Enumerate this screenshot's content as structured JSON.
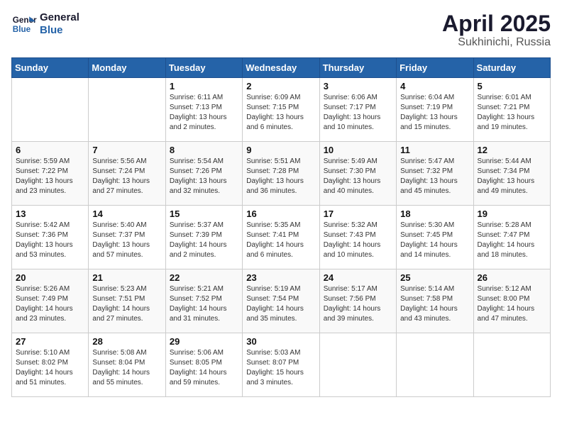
{
  "header": {
    "logo_line1": "General",
    "logo_line2": "Blue",
    "month": "April 2025",
    "location": "Sukhinichi, Russia"
  },
  "weekdays": [
    "Sunday",
    "Monday",
    "Tuesday",
    "Wednesday",
    "Thursday",
    "Friday",
    "Saturday"
  ],
  "weeks": [
    [
      {
        "day": "",
        "info": ""
      },
      {
        "day": "",
        "info": ""
      },
      {
        "day": "1",
        "info": "Sunrise: 6:11 AM\nSunset: 7:13 PM\nDaylight: 13 hours and 2 minutes."
      },
      {
        "day": "2",
        "info": "Sunrise: 6:09 AM\nSunset: 7:15 PM\nDaylight: 13 hours and 6 minutes."
      },
      {
        "day": "3",
        "info": "Sunrise: 6:06 AM\nSunset: 7:17 PM\nDaylight: 13 hours and 10 minutes."
      },
      {
        "day": "4",
        "info": "Sunrise: 6:04 AM\nSunset: 7:19 PM\nDaylight: 13 hours and 15 minutes."
      },
      {
        "day": "5",
        "info": "Sunrise: 6:01 AM\nSunset: 7:21 PM\nDaylight: 13 hours and 19 minutes."
      }
    ],
    [
      {
        "day": "6",
        "info": "Sunrise: 5:59 AM\nSunset: 7:22 PM\nDaylight: 13 hours and 23 minutes."
      },
      {
        "day": "7",
        "info": "Sunrise: 5:56 AM\nSunset: 7:24 PM\nDaylight: 13 hours and 27 minutes."
      },
      {
        "day": "8",
        "info": "Sunrise: 5:54 AM\nSunset: 7:26 PM\nDaylight: 13 hours and 32 minutes."
      },
      {
        "day": "9",
        "info": "Sunrise: 5:51 AM\nSunset: 7:28 PM\nDaylight: 13 hours and 36 minutes."
      },
      {
        "day": "10",
        "info": "Sunrise: 5:49 AM\nSunset: 7:30 PM\nDaylight: 13 hours and 40 minutes."
      },
      {
        "day": "11",
        "info": "Sunrise: 5:47 AM\nSunset: 7:32 PM\nDaylight: 13 hours and 45 minutes."
      },
      {
        "day": "12",
        "info": "Sunrise: 5:44 AM\nSunset: 7:34 PM\nDaylight: 13 hours and 49 minutes."
      }
    ],
    [
      {
        "day": "13",
        "info": "Sunrise: 5:42 AM\nSunset: 7:36 PM\nDaylight: 13 hours and 53 minutes."
      },
      {
        "day": "14",
        "info": "Sunrise: 5:40 AM\nSunset: 7:37 PM\nDaylight: 13 hours and 57 minutes."
      },
      {
        "day": "15",
        "info": "Sunrise: 5:37 AM\nSunset: 7:39 PM\nDaylight: 14 hours and 2 minutes."
      },
      {
        "day": "16",
        "info": "Sunrise: 5:35 AM\nSunset: 7:41 PM\nDaylight: 14 hours and 6 minutes."
      },
      {
        "day": "17",
        "info": "Sunrise: 5:32 AM\nSunset: 7:43 PM\nDaylight: 14 hours and 10 minutes."
      },
      {
        "day": "18",
        "info": "Sunrise: 5:30 AM\nSunset: 7:45 PM\nDaylight: 14 hours and 14 minutes."
      },
      {
        "day": "19",
        "info": "Sunrise: 5:28 AM\nSunset: 7:47 PM\nDaylight: 14 hours and 18 minutes."
      }
    ],
    [
      {
        "day": "20",
        "info": "Sunrise: 5:26 AM\nSunset: 7:49 PM\nDaylight: 14 hours and 23 minutes."
      },
      {
        "day": "21",
        "info": "Sunrise: 5:23 AM\nSunset: 7:51 PM\nDaylight: 14 hours and 27 minutes."
      },
      {
        "day": "22",
        "info": "Sunrise: 5:21 AM\nSunset: 7:52 PM\nDaylight: 14 hours and 31 minutes."
      },
      {
        "day": "23",
        "info": "Sunrise: 5:19 AM\nSunset: 7:54 PM\nDaylight: 14 hours and 35 minutes."
      },
      {
        "day": "24",
        "info": "Sunrise: 5:17 AM\nSunset: 7:56 PM\nDaylight: 14 hours and 39 minutes."
      },
      {
        "day": "25",
        "info": "Sunrise: 5:14 AM\nSunset: 7:58 PM\nDaylight: 14 hours and 43 minutes."
      },
      {
        "day": "26",
        "info": "Sunrise: 5:12 AM\nSunset: 8:00 PM\nDaylight: 14 hours and 47 minutes."
      }
    ],
    [
      {
        "day": "27",
        "info": "Sunrise: 5:10 AM\nSunset: 8:02 PM\nDaylight: 14 hours and 51 minutes."
      },
      {
        "day": "28",
        "info": "Sunrise: 5:08 AM\nSunset: 8:04 PM\nDaylight: 14 hours and 55 minutes."
      },
      {
        "day": "29",
        "info": "Sunrise: 5:06 AM\nSunset: 8:05 PM\nDaylight: 14 hours and 59 minutes."
      },
      {
        "day": "30",
        "info": "Sunrise: 5:03 AM\nSunset: 8:07 PM\nDaylight: 15 hours and 3 minutes."
      },
      {
        "day": "",
        "info": ""
      },
      {
        "day": "",
        "info": ""
      },
      {
        "day": "",
        "info": ""
      }
    ]
  ]
}
